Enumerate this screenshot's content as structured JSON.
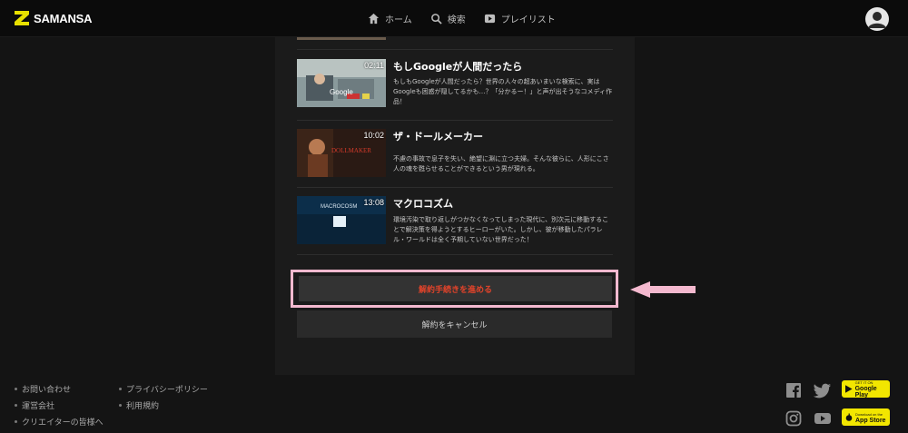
{
  "header": {
    "logo_text": "SAMANSA",
    "nav": [
      {
        "label": "ホーム",
        "icon": "home-icon"
      },
      {
        "label": "検索",
        "icon": "search-icon"
      },
      {
        "label": "プレイリスト",
        "icon": "playlist-icon"
      }
    ],
    "avatar_icon": "user-avatar-icon"
  },
  "videos": [
    {
      "title": "もしGoogleが人間だったら",
      "duration": "02:11",
      "description": "もしもGoogleが人間だったら？世界の人々の超あいまいな検索に、実はGoogleも困惑が隠してるかも…？「分かるー！」と声が出そうなコメディ作品！",
      "thumb_text": "Google"
    },
    {
      "title": "ザ・ドールメーカー",
      "duration": "10:02",
      "description": "不慮の事故で息子を失い、絶望に淵に立つ夫婦。そんな彼らに、人形にこさ人の魂を甦らせることができるという男が現れる。",
      "thumb_text": "DOLLMAKER"
    },
    {
      "title": "マクロコズム",
      "duration": "13:08",
      "description": "環境汚染で取り返しがつかなくなってしまった現代に、別次元に移動することで解決策を得ようとするヒーローがいた。しかし、彼が移動したパラレル・ワールドは全く予期していない世界だった！",
      "thumb_text": "MACROCOSM"
    }
  ],
  "buttons": {
    "proceed": "解約手続きを進める",
    "cancel": "解約をキャンセル"
  },
  "footer": {
    "col1": [
      "お問い合わせ",
      "運営会社",
      "クリエイターの皆様へ"
    ],
    "col2": [
      "プライバシーポリシー",
      "利用規約"
    ],
    "google_play": {
      "top": "GET IT ON",
      "main": "Google Play"
    },
    "app_store": {
      "top": "Download on the",
      "main": "App Store"
    }
  },
  "colors": {
    "accent_red": "#e2432a",
    "highlight_pink": "#f4b9cf",
    "store_yellow": "#f2e600"
  }
}
